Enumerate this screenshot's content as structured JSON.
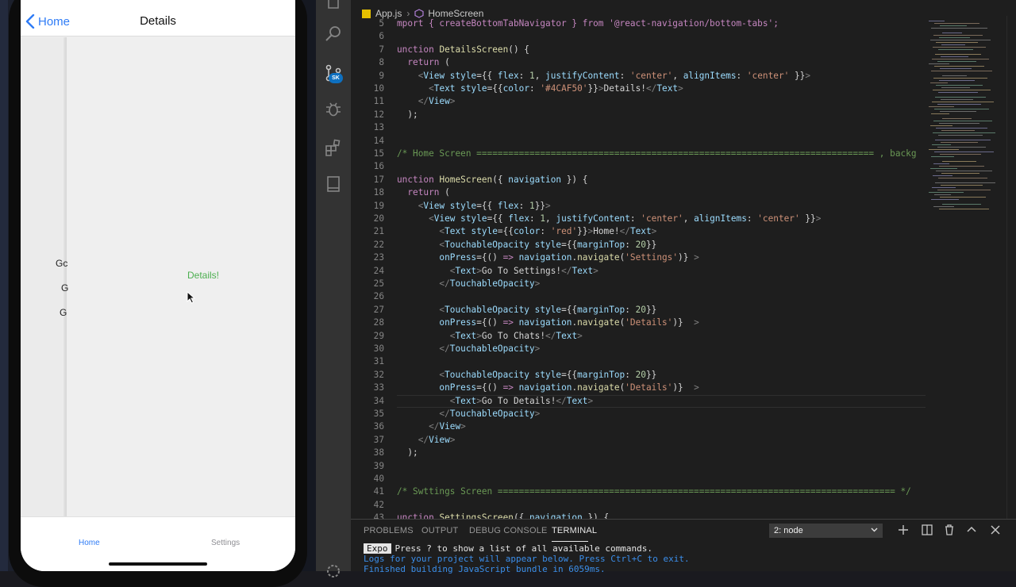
{
  "simulator": {
    "navbar": {
      "back_label": "Home",
      "title": "Details"
    },
    "previous_screen_fragments": [
      "Gc",
      "G",
      "G"
    ],
    "content_text": "Details!",
    "content_color": "#4CAF50",
    "tabs": [
      {
        "label": "Home",
        "active": true
      },
      {
        "label": "Settings",
        "active": false
      }
    ],
    "accent_color": "#2f7cf6"
  },
  "editor": {
    "breadcrumb": {
      "file": "App.js",
      "symbol": "HomeScreen"
    },
    "current_line": 34,
    "lines": [
      {
        "n": "5",
        "tokens": [
          [
            "mport { createBottomTabNavigator } from '@react-navigation/bottom-tabs';",
            "t-k"
          ]
        ]
      },
      {
        "n": "6",
        "tokens": []
      },
      {
        "n": "7",
        "tokens": [
          [
            "unction ",
            "t-k"
          ],
          [
            "DetailsScreen",
            "t-f"
          ],
          [
            "() {",
            "t-d"
          ]
        ]
      },
      {
        "n": "8",
        "tokens": [
          [
            "  return",
            "t-k"
          ],
          [
            " (",
            "t-d"
          ]
        ]
      },
      {
        "n": "9",
        "tokens": [
          [
            "    <",
            "t-g"
          ],
          [
            "View",
            "t-p"
          ],
          [
            " style",
            "t-p"
          ],
          [
            "={{ ",
            "t-d"
          ],
          [
            "flex",
            "t-p"
          ],
          [
            ": ",
            "t-d"
          ],
          [
            "1",
            "t-n"
          ],
          [
            ", ",
            "t-d"
          ],
          [
            "justifyContent",
            "t-p"
          ],
          [
            ": ",
            "t-d"
          ],
          [
            "'center'",
            "t-s"
          ],
          [
            ", ",
            "t-d"
          ],
          [
            "alignItems",
            "t-p"
          ],
          [
            ": ",
            "t-d"
          ],
          [
            "'center'",
            "t-s"
          ],
          [
            " }}",
            "t-d"
          ],
          [
            ">",
            "t-g"
          ]
        ]
      },
      {
        "n": "10",
        "tokens": [
          [
            "      <",
            "t-g"
          ],
          [
            "Text",
            "t-p"
          ],
          [
            " style",
            "t-p"
          ],
          [
            "={{",
            "t-d"
          ],
          [
            "color",
            "t-p"
          ],
          [
            ": ",
            "t-d"
          ],
          [
            "'#4CAF50'",
            "t-s"
          ],
          [
            "}}",
            "t-d"
          ],
          [
            ">",
            "t-g"
          ],
          [
            "Details!",
            "t-d"
          ],
          [
            "</",
            "t-g"
          ],
          [
            "Text",
            "t-p"
          ],
          [
            ">",
            "t-g"
          ]
        ]
      },
      {
        "n": "11",
        "tokens": [
          [
            "    </",
            "t-g"
          ],
          [
            "View",
            "t-p"
          ],
          [
            ">",
            "t-g"
          ]
        ]
      },
      {
        "n": "12",
        "tokens": [
          [
            "  );",
            "t-d"
          ]
        ]
      },
      {
        "n": "13",
        "tokens": []
      },
      {
        "n": "14",
        "tokens": []
      },
      {
        "n": "15",
        "tokens": [
          [
            "/* Home Screen =========================================================================== , backg",
            "t-c"
          ]
        ]
      },
      {
        "n": "16",
        "tokens": []
      },
      {
        "n": "17",
        "tokens": [
          [
            "unction ",
            "t-k"
          ],
          [
            "HomeScreen",
            "t-f"
          ],
          [
            "({ ",
            "t-d"
          ],
          [
            "navigation",
            "t-p"
          ],
          [
            " }) {",
            "t-d"
          ]
        ]
      },
      {
        "n": "18",
        "tokens": [
          [
            "  return",
            "t-k"
          ],
          [
            " (",
            "t-d"
          ]
        ]
      },
      {
        "n": "19",
        "tokens": [
          [
            "    <",
            "t-g"
          ],
          [
            "View",
            "t-p"
          ],
          [
            " style",
            "t-p"
          ],
          [
            "={{ ",
            "t-d"
          ],
          [
            "flex",
            "t-p"
          ],
          [
            ": ",
            "t-d"
          ],
          [
            "1",
            "t-n"
          ],
          [
            "}}",
            "t-d"
          ],
          [
            ">",
            "t-g"
          ]
        ]
      },
      {
        "n": "20",
        "tokens": [
          [
            "      <",
            "t-g"
          ],
          [
            "View",
            "t-p"
          ],
          [
            " style",
            "t-p"
          ],
          [
            "={{ ",
            "t-d"
          ],
          [
            "flex",
            "t-p"
          ],
          [
            ": ",
            "t-d"
          ],
          [
            "1",
            "t-n"
          ],
          [
            ", ",
            "t-d"
          ],
          [
            "justifyContent",
            "t-p"
          ],
          [
            ": ",
            "t-d"
          ],
          [
            "'center'",
            "t-s"
          ],
          [
            ", ",
            "t-d"
          ],
          [
            "alignItems",
            "t-p"
          ],
          [
            ": ",
            "t-d"
          ],
          [
            "'center'",
            "t-s"
          ],
          [
            " }}",
            "t-d"
          ],
          [
            ">",
            "t-g"
          ]
        ]
      },
      {
        "n": "21",
        "tokens": [
          [
            "        <",
            "t-g"
          ],
          [
            "Text",
            "t-p"
          ],
          [
            " style",
            "t-p"
          ],
          [
            "={{",
            "t-d"
          ],
          [
            "color",
            "t-p"
          ],
          [
            ": ",
            "t-d"
          ],
          [
            "'red'",
            "t-s"
          ],
          [
            "}}",
            "t-d"
          ],
          [
            ">",
            "t-g"
          ],
          [
            "Home!",
            "t-d"
          ],
          [
            "</",
            "t-g"
          ],
          [
            "Text",
            "t-p"
          ],
          [
            ">",
            "t-g"
          ]
        ]
      },
      {
        "n": "22",
        "tokens": [
          [
            "        <",
            "t-g"
          ],
          [
            "TouchableOpacity",
            "t-p"
          ],
          [
            " style",
            "t-p"
          ],
          [
            "={{",
            "t-d"
          ],
          [
            "marginTop",
            "t-p"
          ],
          [
            ": ",
            "t-d"
          ],
          [
            "20",
            "t-n"
          ],
          [
            "}}",
            "t-d"
          ]
        ]
      },
      {
        "n": "23",
        "tokens": [
          [
            "        onPress",
            "t-p"
          ],
          [
            "={() ",
            "t-d"
          ],
          [
            "=>",
            "t-k"
          ],
          [
            " navigation",
            "t-p"
          ],
          [
            ".",
            "t-d"
          ],
          [
            "navigate",
            "t-f"
          ],
          [
            "(",
            "t-d"
          ],
          [
            "'Settings'",
            "t-s"
          ],
          [
            ")} ",
            "t-d"
          ],
          [
            ">",
            "t-g"
          ]
        ]
      },
      {
        "n": "24",
        "tokens": [
          [
            "          <",
            "t-g"
          ],
          [
            "Text",
            "t-p"
          ],
          [
            ">",
            "t-g"
          ],
          [
            "Go To Settings!",
            "t-d"
          ],
          [
            "</",
            "t-g"
          ],
          [
            "Text",
            "t-p"
          ],
          [
            ">",
            "t-g"
          ]
        ]
      },
      {
        "n": "25",
        "tokens": [
          [
            "        </",
            "t-g"
          ],
          [
            "TouchableOpacity",
            "t-p"
          ],
          [
            ">",
            "t-g"
          ]
        ]
      },
      {
        "n": "26",
        "tokens": []
      },
      {
        "n": "27",
        "tokens": [
          [
            "        <",
            "t-g"
          ],
          [
            "TouchableOpacity",
            "t-p"
          ],
          [
            " style",
            "t-p"
          ],
          [
            "={{",
            "t-d"
          ],
          [
            "marginTop",
            "t-p"
          ],
          [
            ": ",
            "t-d"
          ],
          [
            "20",
            "t-n"
          ],
          [
            "}}",
            "t-d"
          ]
        ]
      },
      {
        "n": "28",
        "tokens": [
          [
            "        onPress",
            "t-p"
          ],
          [
            "={() ",
            "t-d"
          ],
          [
            "=>",
            "t-k"
          ],
          [
            " navigation",
            "t-p"
          ],
          [
            ".",
            "t-d"
          ],
          [
            "navigate",
            "t-f"
          ],
          [
            "(",
            "t-d"
          ],
          [
            "'Details'",
            "t-s"
          ],
          [
            ")}  ",
            "t-d"
          ],
          [
            ">",
            "t-g"
          ]
        ]
      },
      {
        "n": "29",
        "tokens": [
          [
            "          <",
            "t-g"
          ],
          [
            "Text",
            "t-p"
          ],
          [
            ">",
            "t-g"
          ],
          [
            "Go To Chats!",
            "t-d"
          ],
          [
            "</",
            "t-g"
          ],
          [
            "Text",
            "t-p"
          ],
          [
            ">",
            "t-g"
          ]
        ]
      },
      {
        "n": "30",
        "tokens": [
          [
            "        </",
            "t-g"
          ],
          [
            "TouchableOpacity",
            "t-p"
          ],
          [
            ">",
            "t-g"
          ]
        ]
      },
      {
        "n": "31",
        "tokens": []
      },
      {
        "n": "32",
        "tokens": [
          [
            "        <",
            "t-g"
          ],
          [
            "TouchableOpacity",
            "t-p"
          ],
          [
            " style",
            "t-p"
          ],
          [
            "={{",
            "t-d"
          ],
          [
            "marginTop",
            "t-p"
          ],
          [
            ": ",
            "t-d"
          ],
          [
            "20",
            "t-n"
          ],
          [
            "}}",
            "t-d"
          ]
        ]
      },
      {
        "n": "33",
        "tokens": [
          [
            "        onPress",
            "t-p"
          ],
          [
            "={() ",
            "t-d"
          ],
          [
            "=>",
            "t-k"
          ],
          [
            " navigation",
            "t-p"
          ],
          [
            ".",
            "t-d"
          ],
          [
            "navigate",
            "t-f"
          ],
          [
            "(",
            "t-d"
          ],
          [
            "'Details'",
            "t-s"
          ],
          [
            ")}  ",
            "t-d"
          ],
          [
            ">",
            "t-g"
          ]
        ]
      },
      {
        "n": "34",
        "tokens": [
          [
            "          <",
            "t-g"
          ],
          [
            "Text",
            "t-p"
          ],
          [
            ">",
            "t-g"
          ],
          [
            "Go To Details!",
            "t-d"
          ],
          [
            "</",
            "t-g"
          ],
          [
            "Text",
            "t-p"
          ],
          [
            ">",
            "t-g"
          ]
        ]
      },
      {
        "n": "35",
        "tokens": [
          [
            "        </",
            "t-g"
          ],
          [
            "TouchableOpacity",
            "t-p"
          ],
          [
            ">",
            "t-g"
          ]
        ]
      },
      {
        "n": "36",
        "tokens": [
          [
            "      </",
            "t-g"
          ],
          [
            "View",
            "t-p"
          ],
          [
            ">",
            "t-g"
          ]
        ]
      },
      {
        "n": "37",
        "tokens": [
          [
            "    </",
            "t-g"
          ],
          [
            "View",
            "t-p"
          ],
          [
            ">",
            "t-g"
          ]
        ]
      },
      {
        "n": "38",
        "tokens": [
          [
            "  );",
            "t-d"
          ]
        ]
      },
      {
        "n": "39",
        "tokens": []
      },
      {
        "n": "40",
        "tokens": []
      },
      {
        "n": "41",
        "tokens": [
          [
            "/* Swttings Screen =========================================================================== */",
            "t-c"
          ]
        ]
      },
      {
        "n": "42",
        "tokens": []
      },
      {
        "n": "43",
        "tokens": [
          [
            "unction ",
            "t-k"
          ],
          [
            "SettingsScreen",
            "t-f"
          ],
          [
            "({ ",
            "t-d"
          ],
          [
            "navigation",
            "t-p"
          ],
          [
            " }) {",
            "t-d"
          ]
        ]
      }
    ]
  },
  "panel": {
    "tabs": [
      "PROBLEMS",
      "OUTPUT",
      "DEBUG CONSOLE",
      "TERMINAL"
    ],
    "active_tab": "TERMINAL",
    "terminal_select": "2: node",
    "terminal_lines": [
      {
        "badge": "Expo",
        "text": "Press ? to show a list of all available commands.",
        "color": "t-white"
      },
      {
        "badge": "",
        "text": "Logs for your project will appear below. Press Ctrl+C to exit.",
        "color": "t-blue"
      },
      {
        "badge": "",
        "text": "Finished building JavaScript bundle in 6059ms.",
        "color": "t-blue"
      }
    ]
  }
}
